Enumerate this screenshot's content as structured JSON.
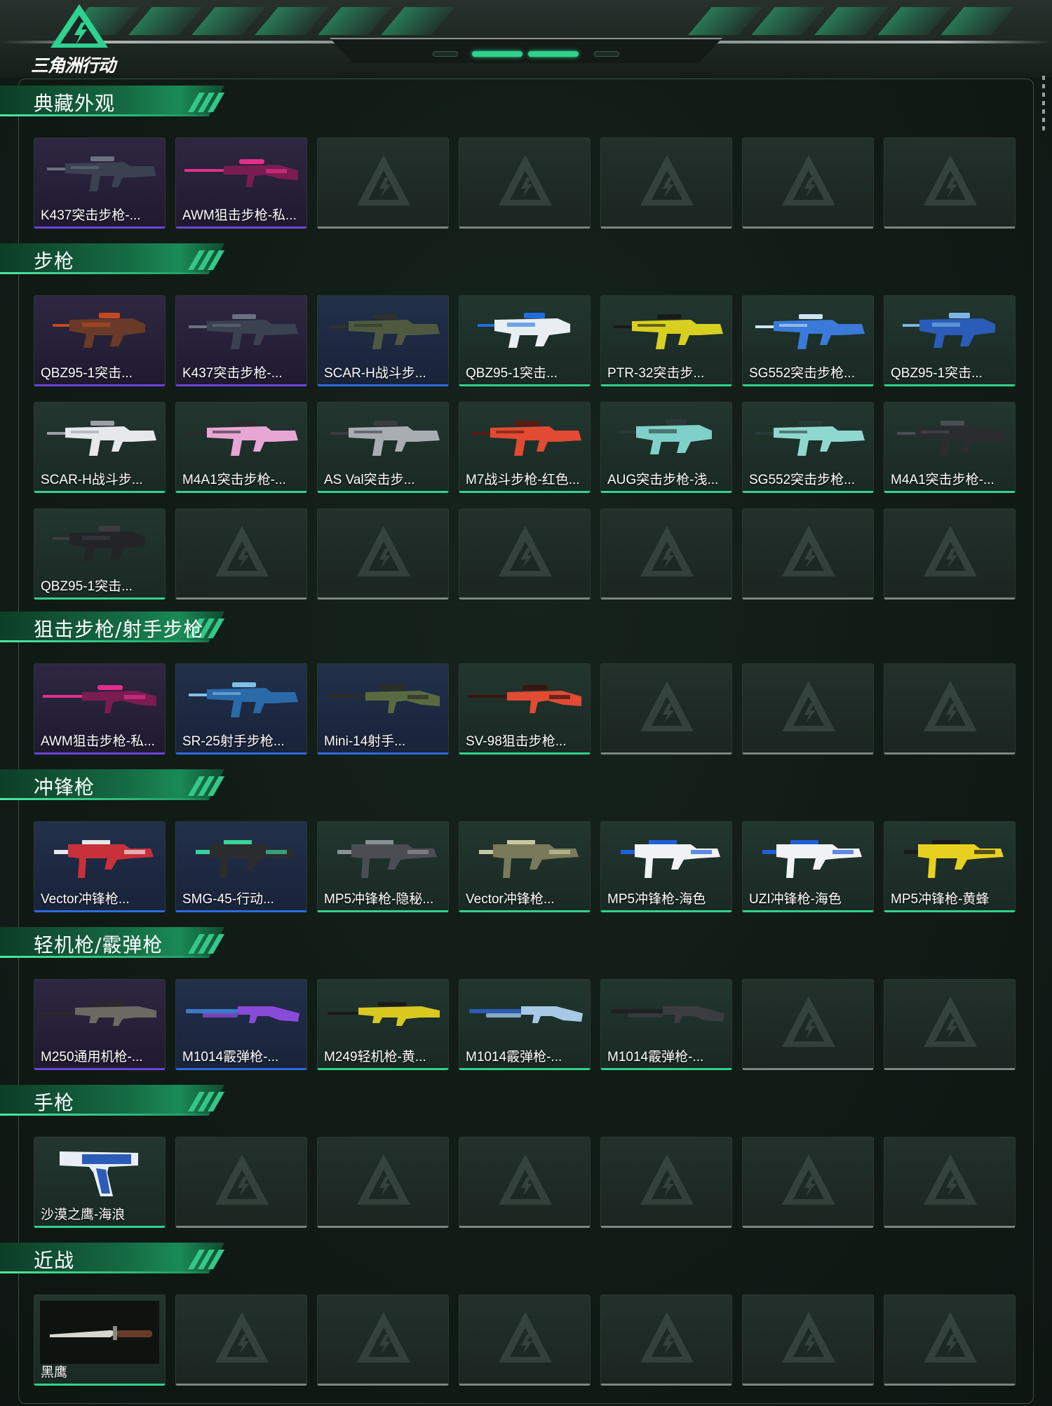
{
  "header": {
    "logo_text": "三角洲行动",
    "page_indicator": {
      "total": 4,
      "active": 2
    }
  },
  "colors": {
    "accent_green": "#2fd28f",
    "rarity_purple": "#6a45d8",
    "rarity_blue": "#2f6be0",
    "rarity_green": "#2fd28f",
    "empty_slot": "#7b8681"
  },
  "sections": [
    {
      "title": "典藏外观",
      "slots": 7,
      "items": [
        {
          "name": "K437突击步枪-...",
          "rarity": "purple",
          "icon": "rifle-icon",
          "primary": "#3a4150",
          "accent": "#6b7080"
        },
        {
          "name": "AWM狙击步枪-私...",
          "rarity": "purple",
          "icon": "sniper-icon",
          "primary": "#7a1c52",
          "accent": "#e0308c"
        }
      ]
    },
    {
      "title": "步枪",
      "slots": 21,
      "items": [
        {
          "name": "QBZ95-1突击...",
          "rarity": "purple",
          "icon": "bullpup-icon",
          "primary": "#6a3a28",
          "accent": "#c24a1e"
        },
        {
          "name": "K437突击步枪-...",
          "rarity": "purple",
          "icon": "rifle-icon",
          "primary": "#3a4150",
          "accent": "#6b7080"
        },
        {
          "name": "SCAR-H战斗步...",
          "rarity": "blue",
          "icon": "rifle-icon",
          "primary": "#4e5a40",
          "accent": "#2d3328"
        },
        {
          "name": "QBZ95-1突击...",
          "rarity": "green",
          "icon": "bullpup-icon",
          "primary": "#e8eef2",
          "accent": "#1f6fe0"
        },
        {
          "name": "PTR-32突击步...",
          "rarity": "green",
          "icon": "rifle-icon",
          "primary": "#d8d020",
          "accent": "#1a1a1a"
        },
        {
          "name": "SG552突击步枪...",
          "rarity": "green",
          "icon": "rifle-icon",
          "primary": "#3a7ad8",
          "accent": "#cfe3f6"
        },
        {
          "name": "QBZ95-1突击...",
          "rarity": "green",
          "icon": "bullpup-icon",
          "primary": "#2a5cb8",
          "accent": "#7fb4e8"
        },
        {
          "name": "SCAR-H战斗步...",
          "rarity": "green",
          "icon": "rifle-icon",
          "primary": "#e6e8ea",
          "accent": "#9aa0a6"
        },
        {
          "name": "M4A1突击步枪-...",
          "rarity": "green",
          "icon": "rifle-icon",
          "primary": "#e8a6d4",
          "accent": "#2a2a2a"
        },
        {
          "name": "AS Val突击步...",
          "rarity": "green",
          "icon": "rifle-icon",
          "primary": "#a8adb2",
          "accent": "#3a3d40"
        },
        {
          "name": "M7战斗步枪-红色...",
          "rarity": "green",
          "icon": "rifle-icon",
          "primary": "#e24a32",
          "accent": "#5a1a10"
        },
        {
          "name": "AUG突击步枪-浅...",
          "rarity": "green",
          "icon": "bullpup-icon",
          "primary": "#7fd0c8",
          "accent": "#2a3a38"
        },
        {
          "name": "SG552突击步枪...",
          "rarity": "green",
          "icon": "rifle-icon",
          "primary": "#8fd8cf",
          "accent": "#2a3a38"
        },
        {
          "name": "M4A1突击步枪-...",
          "rarity": "green",
          "icon": "rifle-icon",
          "primary": "#2a2c2e",
          "accent": "#4a4e52"
        },
        {
          "name": "QBZ95-1突击...",
          "rarity": "green",
          "icon": "bullpup-icon",
          "primary": "#222426",
          "accent": "#3a3d40"
        }
      ]
    },
    {
      "title": "狙击步枪/射手步枪",
      "slots": 7,
      "items": [
        {
          "name": "AWM狙击步枪-私...",
          "rarity": "purple",
          "icon": "sniper-icon",
          "primary": "#7a1c52",
          "accent": "#e0308c"
        },
        {
          "name": "SR-25射手步枪...",
          "rarity": "blue",
          "icon": "rifle-icon",
          "primary": "#2a6aa8",
          "accent": "#7ec0e8"
        },
        {
          "name": "Mini-14射手...",
          "rarity": "blue",
          "icon": "sniper-icon",
          "primary": "#5a6a40",
          "accent": "#2a2e24"
        },
        {
          "name": "SV-98狙击步枪...",
          "rarity": "green",
          "icon": "sniper-icon",
          "primary": "#e24a32",
          "accent": "#3a1410"
        }
      ]
    },
    {
      "title": "冲锋枪",
      "slots": 7,
      "items": [
        {
          "name": "Vector冲锋枪...",
          "rarity": "blue",
          "icon": "smg-icon",
          "primary": "#c8303a",
          "accent": "#e8e8e8"
        },
        {
          "name": "SMG-45-行动...",
          "rarity": "blue",
          "icon": "smg-icon",
          "primary": "#2a2c2e",
          "accent": "#3ad29a"
        },
        {
          "name": "MP5冲锋枪-隐秘...",
          "rarity": "green",
          "icon": "smg-icon",
          "primary": "#4a4e52",
          "accent": "#8a9096"
        },
        {
          "name": "Vector冲锋枪...",
          "rarity": "green",
          "icon": "smg-icon",
          "primary": "#7a7a5a",
          "accent": "#c8c8a0"
        },
        {
          "name": "MP5冲锋枪-海色",
          "rarity": "green",
          "icon": "smg-icon",
          "primary": "#f0f2f4",
          "accent": "#1f5fd8"
        },
        {
          "name": "UZI冲锋枪-海色",
          "rarity": "green",
          "icon": "smg-icon",
          "primary": "#f0f2f4",
          "accent": "#1f5fd8"
        },
        {
          "name": "MP5冲锋枪-黄蜂",
          "rarity": "green",
          "icon": "smg-icon",
          "primary": "#e8d020",
          "accent": "#1a1a1a"
        }
      ]
    },
    {
      "title": "轻机枪/霰弹枪",
      "slots": 7,
      "items": [
        {
          "name": "M250通用机枪-...",
          "rarity": "purple",
          "icon": "lmg-icon",
          "primary": "#6a6a62",
          "accent": "#2a2a26"
        },
        {
          "name": "M1014霰弹枪-...",
          "rarity": "blue",
          "icon": "shotgun-icon",
          "primary": "#3a7ac8",
          "accent": "#8a4ad8"
        },
        {
          "name": "M249轻机枪-黄...",
          "rarity": "green",
          "icon": "lmg-icon",
          "primary": "#d8c820",
          "accent": "#1a1a1a"
        },
        {
          "name": "M1014霰弹枪-...",
          "rarity": "green",
          "icon": "shotgun-icon",
          "primary": "#2a5cb8",
          "accent": "#a8c8e8"
        },
        {
          "name": "M1014霰弹枪-...",
          "rarity": "green",
          "icon": "shotgun-icon",
          "primary": "#1e2022",
          "accent": "#3a3d40"
        }
      ]
    },
    {
      "title": "手枪",
      "slots": 7,
      "items": [
        {
          "name": "沙漠之鹰-海浪",
          "rarity": "green",
          "icon": "pistol-icon",
          "primary": "#2a5cb8",
          "accent": "#e8eef4"
        }
      ]
    },
    {
      "title": "近战",
      "slots": 7,
      "items": [
        {
          "name": "黑鹰",
          "rarity": "green",
          "icon": "knife-icon",
          "primary": "#d8d8d0",
          "accent": "#6a3a28"
        }
      ]
    }
  ]
}
